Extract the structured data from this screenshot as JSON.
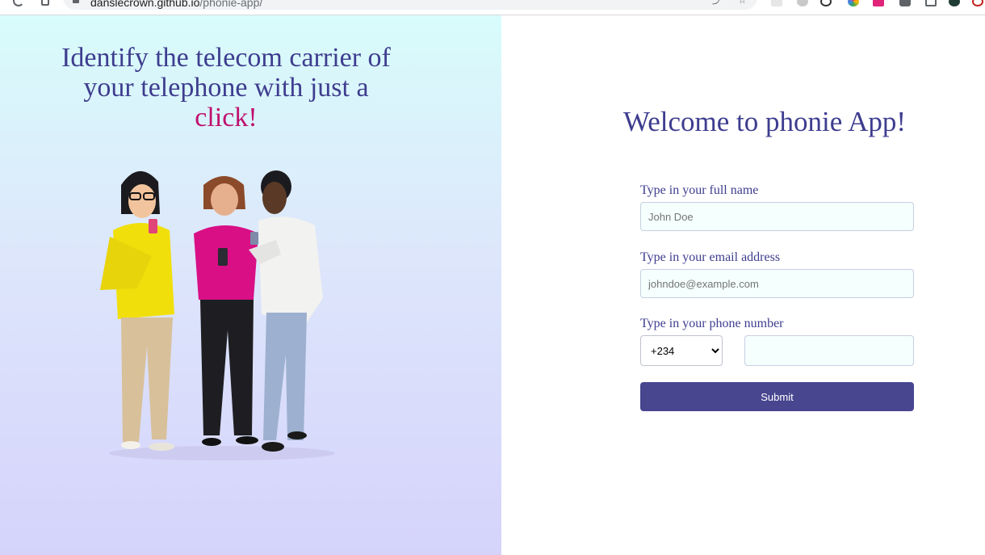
{
  "browser": {
    "url_host": "danslecrown.github.io",
    "url_path": "/phonie-app/"
  },
  "hero": {
    "title_main": "Identify the telecom carrier of your telephone with just a",
    "title_accent": "click!",
    "illustration_icon": "three-people-with-phones-illustration"
  },
  "form": {
    "welcome": "Welcome to phonie App!",
    "name_label": "Type in your full name",
    "name_placeholder": "John Doe",
    "name_value": "",
    "email_label": "Type in your email address",
    "email_placeholder": "johndoe@example.com",
    "email_value": "",
    "phone_label": "Type in your phone number",
    "country_code": "+234",
    "phone_value": "",
    "submit_label": "Submit"
  },
  "colors": {
    "brand": "#3e3d8f",
    "accent": "#c0106e",
    "button": "#48468f"
  }
}
